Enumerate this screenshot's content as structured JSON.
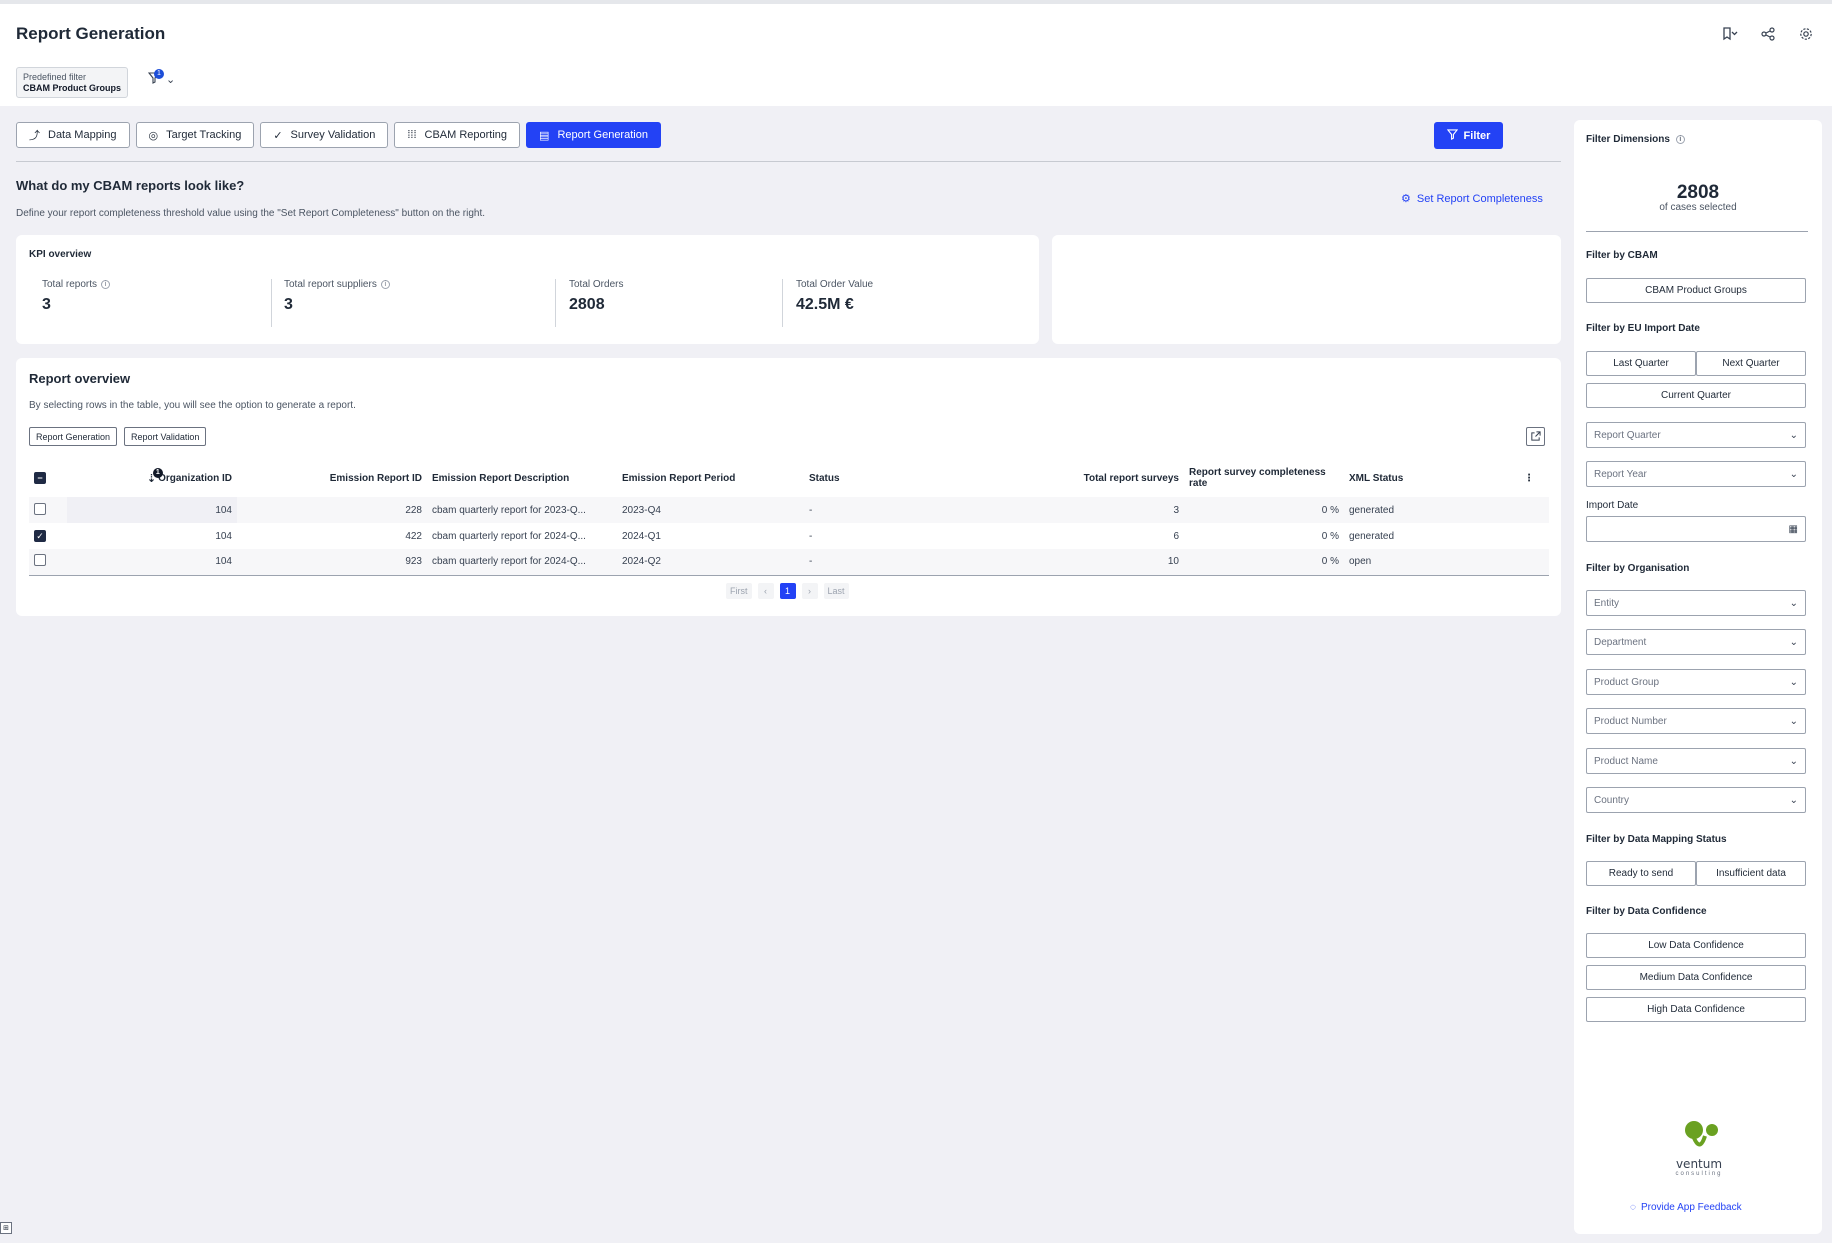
{
  "header": {
    "title": "Report Generation",
    "predefined_filter_label": "Predefined filter",
    "predefined_filter_value": "CBAM Product Groups",
    "filter_badge": "1"
  },
  "tabs": [
    {
      "label": "Data Mapping",
      "icon": "mapping-icon"
    },
    {
      "label": "Target Tracking",
      "icon": "target-icon"
    },
    {
      "label": "Survey Validation",
      "icon": "check-icon"
    },
    {
      "label": "CBAM Reporting",
      "icon": "grid-icon"
    },
    {
      "label": "Report Generation",
      "icon": "document-icon",
      "active": true
    }
  ],
  "filter_button_label": "Filter",
  "intro": {
    "heading": "What do my CBAM reports look like?",
    "description": "Define your report completeness threshold value using the \"Set Report Completeness\" button on the right.",
    "set_completeness_label": "Set Report Completeness"
  },
  "kpi": {
    "title": "KPI overview",
    "items": [
      {
        "label": "Total reports",
        "value": "3"
      },
      {
        "label": "Total report suppliers",
        "value": "3"
      },
      {
        "label": "Total Orders",
        "value": "2808"
      },
      {
        "label": "Total Order Value",
        "value": "42.5M €"
      }
    ]
  },
  "report": {
    "title": "Report overview",
    "subtitle": "By selecting rows in the table, you will see the option to generate a report.",
    "buttons": [
      "Report Generation",
      "Report Validation"
    ],
    "sort_badge": "1",
    "columns": [
      "Organization ID",
      "Emission Report ID",
      "Emission Report Description",
      "Emission Report Period",
      "Status",
      "Total report surveys",
      "Report survey completeness rate",
      "XML Status"
    ],
    "rows": [
      {
        "org_id": "104",
        "report_id": "228",
        "description": "cbam quarterly report for 2023-Q...",
        "period": "2023-Q4",
        "status": "-",
        "surveys": "3",
        "rate": "0 %",
        "xml": "generated",
        "checked": false
      },
      {
        "org_id": "104",
        "report_id": "422",
        "description": "cbam quarterly report for 2024-Q...",
        "period": "2024-Q1",
        "status": "-",
        "surveys": "6",
        "rate": "0 %",
        "xml": "generated",
        "checked": true
      },
      {
        "org_id": "104",
        "report_id": "923",
        "description": "cbam quarterly report for 2024-Q...",
        "period": "2024-Q2",
        "status": "-",
        "surveys": "10",
        "rate": "0 %",
        "xml": "open",
        "checked": false
      }
    ],
    "pager": {
      "first": "First",
      "last": "Last",
      "current": "1"
    }
  },
  "sidebar": {
    "title": "Filter Dimensions",
    "count": "2808",
    "count_sub": "of cases selected",
    "cbam_heading": "Filter by CBAM",
    "cbam_button": "CBAM Product Groups",
    "eu_heading": "Filter by EU Import Date",
    "last_quarter": "Last Quarter",
    "next_quarter": "Next Quarter",
    "current_quarter": "Current Quarter",
    "report_quarter": "Report Quarter",
    "report_year": "Report Year",
    "import_date_label": "Import Date",
    "org_heading": "Filter by Organisation",
    "org_selects": [
      "Entity",
      "Department",
      "Product Group",
      "Product Number",
      "Product Name",
      "Country"
    ],
    "mapping_heading": "Filter by Data Mapping Status",
    "ready_to_send": "Ready to send",
    "insufficient_data": "Insufficient data",
    "confidence_heading": "Filter by Data Confidence",
    "confidence_buttons": [
      "Low Data Confidence",
      "Medium Data Confidence",
      "High Data Confidence"
    ],
    "logo_brand": "ventum",
    "logo_sub": "consulting",
    "feedback": "Provide App Feedback"
  },
  "colors": {
    "accent": "#2342f5",
    "red": "#ef4444",
    "logo_green": "#6aa121"
  }
}
